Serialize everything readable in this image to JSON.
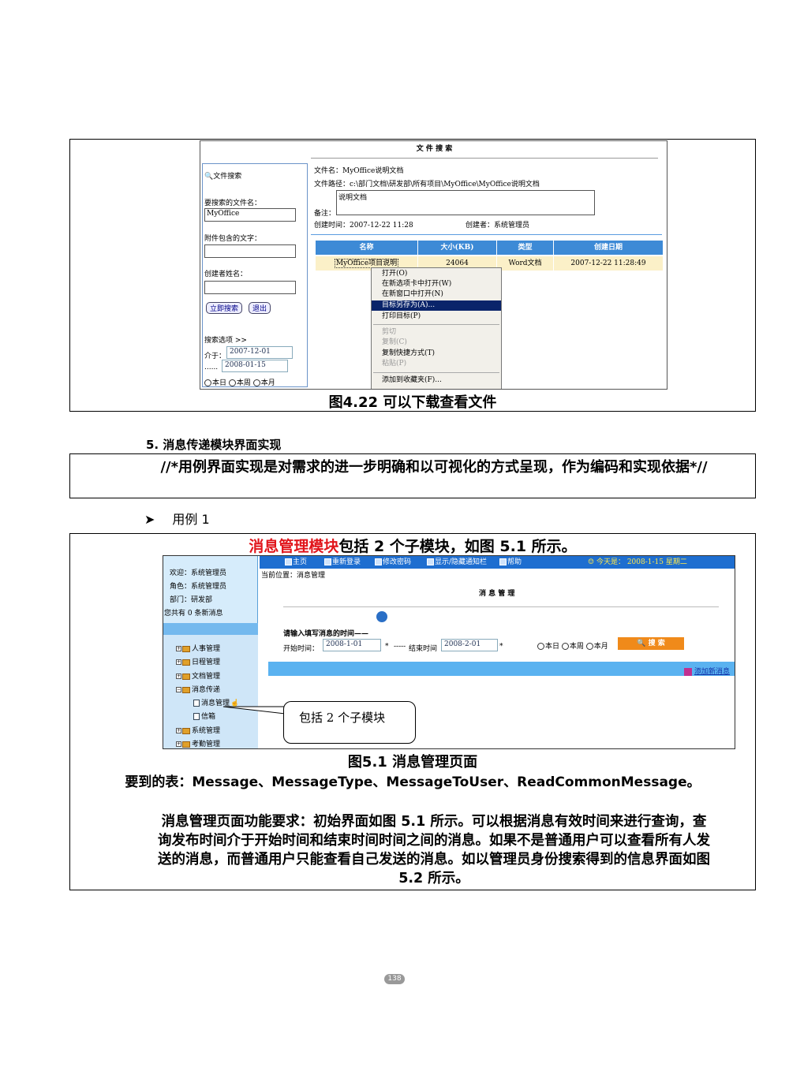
{
  "figure1": {
    "title": "文 件 搜 索",
    "search_label": "文件搜索",
    "filename_label": "要搜索的文件名：",
    "filename_value": "MyOffice",
    "attach_text_label": "附件包含的文字：",
    "creator_label": "创建者姓名：",
    "search_button": "立即搜索",
    "back_button": "退出",
    "search_options": "搜索选项 >>",
    "between_label": "介于：",
    "date_from": "2007-12-01",
    "range_sep": "......",
    "date_to": "2008-01-15",
    "radios": [
      "本日",
      "本周",
      "本月"
    ],
    "detail": {
      "name": "文件名：MyOffice说明文档",
      "path": "文件路径：c:\\部门文档\\研发部\\所有项目\\MyOffice\\MyOffice说明文档",
      "note_value": "说明文档",
      "note_label": "备注：",
      "created_time": "创建时间：2007-12-22 11:28",
      "creator": "创建者：系统管理员"
    },
    "table": {
      "headers": [
        "名称",
        "大小(KB)",
        "类型",
        "创建日期"
      ],
      "row": [
        "MyOffice项目说明",
        "24064",
        "Word文档",
        "2007-12-22 11:28:49"
      ]
    },
    "context_menu": [
      "打开(O)",
      "在新选项卡中打开(W)",
      "在新窗口中打开(N)",
      "目标另存为(A)...",
      "打印目标(P)",
      "剪切",
      "复制(C)",
      "复制快捷方式(T)",
      "粘贴(P)",
      "添加到收藏夹(F)..."
    ],
    "caption": "图4.22 可以下载查看文件"
  },
  "section5": {
    "heading": "5. 消息传递模块界面实现",
    "note": "//*用例界面实现是对需求的进一步明确和以可视化的方式呈现，作为编码和实现依据*//",
    "usecase": "用例 1"
  },
  "figure2": {
    "title_red": "消息管理模块",
    "title_rest": "包括 2 个子模块，如图 5.1 所示。",
    "sidebar": {
      "welcome": "欢迎：系统管理员",
      "role": "角色：系统管理员",
      "dept": "部门：研发部",
      "msgs": "您共有 0 条新消息"
    },
    "tree": [
      "人事管理",
      "日程管理",
      "文档管理",
      "消息传递",
      "消息管理",
      "信箱",
      "系统管理",
      "考勤管理"
    ],
    "nav": [
      "主页",
      "重新登录",
      "修改密码",
      "显示/隐藏通知栏",
      "帮助"
    ],
    "today": "今天是： 2008-1-15 星期二",
    "location": "当前位置：消息管理",
    "page_title": "消 息 管 理",
    "prompt": "请输入填写消息的时间——",
    "start_label": "开始时间：",
    "start_value": "2008-1-01",
    "end_sep": "-----",
    "end_label": "结束时间",
    "end_value": "2008-2-01",
    "star": "*",
    "radios": [
      "本日",
      "本周",
      "本月"
    ],
    "search_btn": "搜 索",
    "add_link": "添加新消息",
    "callout": "包括 2 个子模块",
    "caption": "图5.1 消息管理页面"
  },
  "tables_text": "要到的表：Message、MessageType、MessageToUser、ReadCommonMessage。",
  "requirements": "消息管理页面功能要求：初始界面如图 5.1 所示。可以根据消息有效时间来进行查询，查询发布时间介于开始时间和结束时间时间之间的消息。如果不是普通用户可以查看所有人发送的消息，而普通用户只能查看自己发送的消息。如以管理员身份搜索得到的信息界面如图 5.2 所示。",
  "page_number": "138"
}
